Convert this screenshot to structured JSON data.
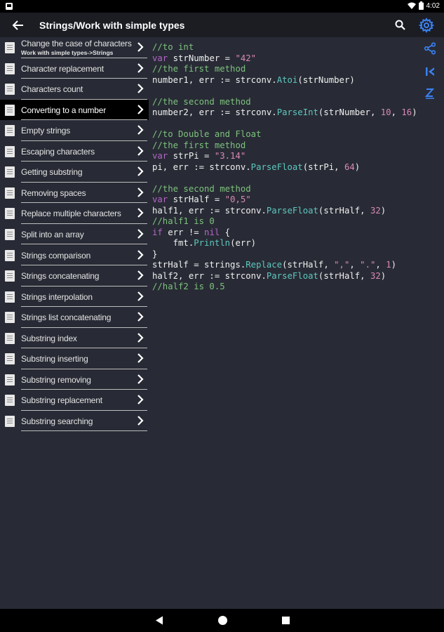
{
  "status_bar": {
    "time": "4:02"
  },
  "app_bar": {
    "title": "Strings/Work with simple types"
  },
  "sidebar": {
    "items": [
      {
        "label": "Change the case of characters",
        "sub": "Work with simple types->Strings"
      },
      {
        "label": "Character replacement"
      },
      {
        "label": "Characters count"
      },
      {
        "label": "Converting to a number",
        "active": true
      },
      {
        "label": "Empty strings"
      },
      {
        "label": "Escaping characters"
      },
      {
        "label": "Getting substring"
      },
      {
        "label": "Removing spaces"
      },
      {
        "label": "Replace multiple characters"
      },
      {
        "label": "Split into an array"
      },
      {
        "label": "Strings comparison"
      },
      {
        "label": "Strings concatenating"
      },
      {
        "label": "Strings interpolation"
      },
      {
        "label": "Strings list concatenating"
      },
      {
        "label": "Substring index"
      },
      {
        "label": "Substring inserting"
      },
      {
        "label": "Substring removing"
      },
      {
        "label": "Substring replacement"
      },
      {
        "label": "Substring searching"
      }
    ]
  },
  "code": {
    "lines": [
      [
        [
          "c",
          "//to int"
        ]
      ],
      [
        [
          "k",
          "var"
        ],
        [
          "p",
          " strNumber = "
        ],
        [
          "s",
          "\"42\""
        ]
      ],
      [
        [
          "c",
          "//the first method"
        ]
      ],
      [
        [
          "p",
          "number1, err := strconv."
        ],
        [
          "f",
          "Atoi"
        ],
        [
          "p",
          "(strNumber)"
        ]
      ],
      [],
      [
        [
          "c",
          "//the second method"
        ]
      ],
      [
        [
          "p",
          "number2, err := strconv."
        ],
        [
          "f",
          "ParseInt"
        ],
        [
          "p",
          "(strNumber, "
        ],
        [
          "n",
          "10"
        ],
        [
          "p",
          ", "
        ],
        [
          "n",
          "16"
        ],
        [
          "p",
          ")"
        ]
      ],
      [],
      [
        [
          "c",
          "//to Double and Float"
        ]
      ],
      [
        [
          "c",
          "//the first method"
        ]
      ],
      [
        [
          "k",
          "var"
        ],
        [
          "p",
          " strPi = "
        ],
        [
          "s",
          "\"3.14\""
        ]
      ],
      [
        [
          "p",
          "pi, err := strconv."
        ],
        [
          "f",
          "ParseFloat"
        ],
        [
          "p",
          "(strPi, "
        ],
        [
          "n",
          "64"
        ],
        [
          "p",
          ")"
        ]
      ],
      [],
      [
        [
          "c",
          "//the second method"
        ]
      ],
      [
        [
          "k",
          "var"
        ],
        [
          "p",
          " strHalf = "
        ],
        [
          "s",
          "\"0,5\""
        ]
      ],
      [
        [
          "p",
          "half1, err := strconv."
        ],
        [
          "f",
          "ParseFloat"
        ],
        [
          "p",
          "(strHalf, "
        ],
        [
          "n",
          "32"
        ],
        [
          "p",
          ")"
        ]
      ],
      [
        [
          "c",
          "//half1 is 0"
        ]
      ],
      [
        [
          "k",
          "if"
        ],
        [
          "p",
          " err != "
        ],
        [
          "k",
          "nil"
        ],
        [
          "p",
          " {"
        ]
      ],
      [
        [
          "p",
          "    fmt."
        ],
        [
          "f",
          "Println"
        ],
        [
          "p",
          "(err)"
        ]
      ],
      [
        [
          "p",
          "}"
        ]
      ],
      [
        [
          "p",
          "strHalf = strings."
        ],
        [
          "f",
          "Replace"
        ],
        [
          "p",
          "(strHalf, "
        ],
        [
          "s",
          "\",\""
        ],
        [
          "p",
          ", "
        ],
        [
          "s",
          "\".\""
        ],
        [
          "p",
          ", "
        ],
        [
          "n",
          "1"
        ],
        [
          "p",
          ")"
        ]
      ],
      [
        [
          "p",
          "half2, err := strconv."
        ],
        [
          "f",
          "ParseFloat"
        ],
        [
          "p",
          "(strHalf, "
        ],
        [
          "n",
          "32"
        ],
        [
          "p",
          ")"
        ]
      ],
      [
        [
          "c",
          "//half2 is 0.5"
        ]
      ]
    ]
  },
  "icons": {
    "back": "arrow-left-icon",
    "search": "search-icon",
    "settings": "gear-icon",
    "share": "share-icon",
    "first": "skip-first-icon",
    "sort": "sort-z-icon"
  },
  "colors": {
    "background": "#282b35",
    "app_bar": "#1b1d23",
    "accent": "#3b82f6",
    "comment": "#7ec27e",
    "string": "#d98ab8",
    "keyword": "#b565c9",
    "function": "#5ec7c0"
  }
}
